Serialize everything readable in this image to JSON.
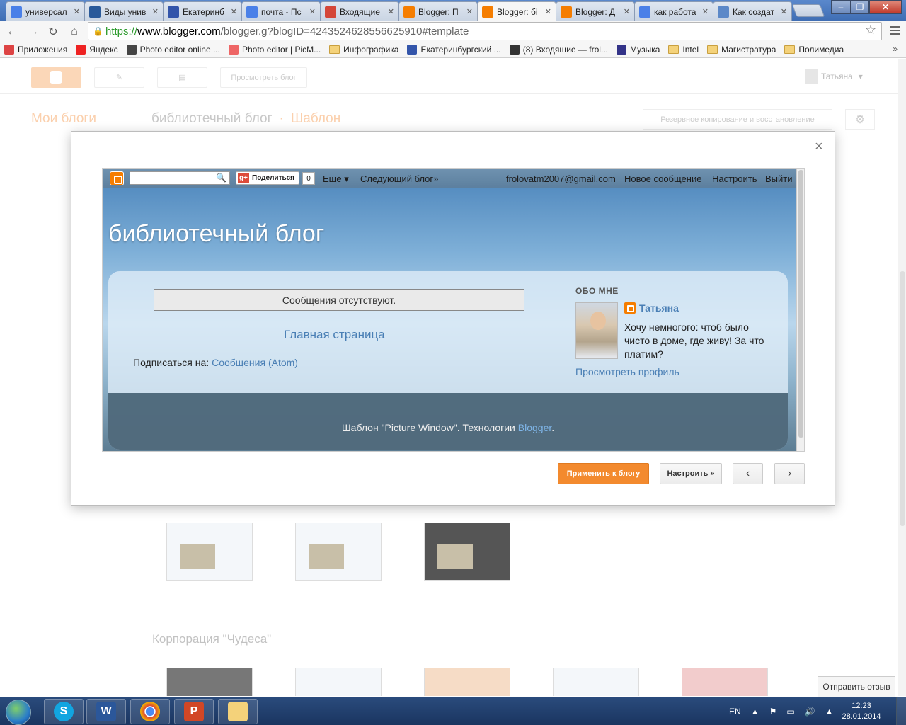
{
  "browser": {
    "tabs": [
      {
        "title": "универсал",
        "icon": "google-icon",
        "color": "#4a80e8"
      },
      {
        "title": "Виды унив",
        "icon": "m-icon",
        "color": "#2a5a9a"
      },
      {
        "title": "Екатеринб",
        "icon": "site-icon",
        "color": "#3355aa"
      },
      {
        "title": "почта - Пс",
        "icon": "google-icon",
        "color": "#4a80e8"
      },
      {
        "title": "Входящие",
        "icon": "gmail-icon",
        "color": "#d44638"
      },
      {
        "title": "Blogger: П",
        "icon": "blogger-icon",
        "color": "#f57d00"
      },
      {
        "title": "Blogger: бі",
        "icon": "blogger-icon",
        "color": "#f57d00"
      },
      {
        "title": "Blogger: Д",
        "icon": "blogger-icon",
        "color": "#f57d00"
      },
      {
        "title": "как работа",
        "icon": "google-icon",
        "color": "#4a80e8"
      },
      {
        "title": "Как создат",
        "icon": "loading-icon",
        "color": "#5b88c8"
      }
    ],
    "url": {
      "scheme": "https://",
      "host": "www.blogger.com",
      "path": "/blogger.g?blogID=4243524628556625910#template"
    },
    "bookmarks": [
      {
        "label": "Приложения",
        "icon": "apps-icon"
      },
      {
        "label": "Яндекс",
        "icon": "yandex-icon"
      },
      {
        "label": "Photo editor online ...",
        "icon": "brush-icon"
      },
      {
        "label": "Photo editor | PicM...",
        "icon": "picmonkey-icon"
      },
      {
        "label": "Инфографика",
        "icon": "folder-icon"
      },
      {
        "label": "Екатеринбургский ...",
        "icon": "site-icon"
      },
      {
        "label": "(8) Входящие — frol...",
        "icon": "mail-icon"
      },
      {
        "label": "Музыка",
        "icon": "play-icon"
      },
      {
        "label": "Intel",
        "icon": "folder-icon"
      },
      {
        "label": "Магистратура",
        "icon": "folder-icon"
      },
      {
        "label": "Полимедиа",
        "icon": "folder-icon"
      }
    ],
    "bookmarks_more": "»"
  },
  "blogger": {
    "view_blog": "Просмотреть блог",
    "user_name": "Татьяна",
    "crumb_my_blogs": "Мои блоги",
    "crumb_blog": "библиотечный блог",
    "crumb_sep": "·",
    "crumb_template": "Шаблон",
    "backup_restore": "Резервное копирование и восстановление",
    "section_title": "Корпорация \"Чудеса\"",
    "feedback": "Отправить отзыв"
  },
  "modal": {
    "close": "×",
    "apply_button": "Применить к блогу",
    "customize_button": "Настроить »",
    "prev": "‹",
    "next": "›",
    "preview": {
      "navbar": {
        "share": "Поделиться",
        "share_count": "0",
        "more": "Ещё ▾",
        "next_blog": "Следующий блог»",
        "email": "frolovatm2007@gmail.com",
        "new_post": "Новое сообщение",
        "customize": "Настроить",
        "logout": "Выйти"
      },
      "blog_title": "библиотечный блог",
      "no_posts": "Сообщения отсутствуют.",
      "home_link": "Главная страница",
      "subscribe_label": "Подписаться на:",
      "subscribe_link": "Сообщения (Atom)",
      "about_heading": "ОБО МНЕ",
      "about_name": "Татьяна",
      "about_text": "Хочу немногого: чтоб было чисто в доме, где живу! За что платим?",
      "view_profile": "Просмотреть профиль",
      "footer_prefix": "Шаблон \"Picture Window\". Технологии ",
      "footer_link": "Blogger",
      "footer_suffix": "."
    }
  },
  "taskbar": {
    "apps": [
      "skype-icon",
      "word-icon",
      "chrome-icon",
      "powerpoint-icon",
      "explorer-icon"
    ],
    "lang": "EN",
    "time": "12:23",
    "date": "28.01.2014"
  }
}
